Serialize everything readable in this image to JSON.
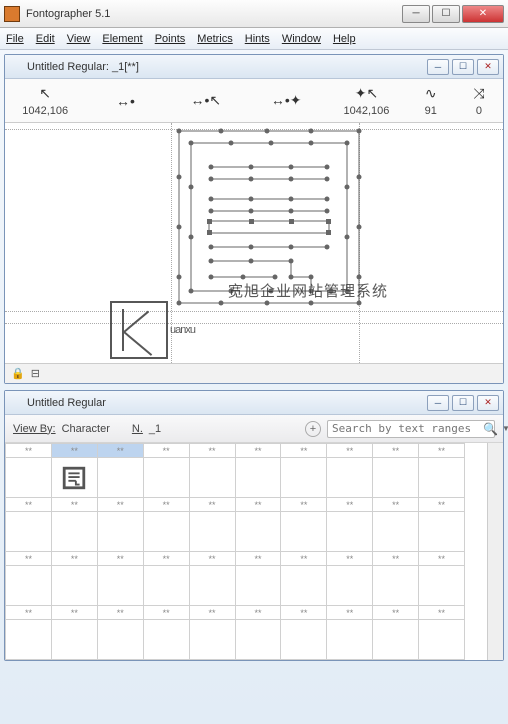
{
  "app": {
    "title": "Fontographer 5.1"
  },
  "menu": {
    "file": "File",
    "edit": "Edit",
    "view": "View",
    "element": "Element",
    "points": "Points",
    "metrics": "Metrics",
    "hints": "Hints",
    "window": "Window",
    "help": "Help"
  },
  "editor": {
    "title": "Untitled Regular: _1[**]",
    "toolbar": {
      "coords_left": "1042,106",
      "coords_right": "1042,106",
      "val_91": "91",
      "val_0": "0",
      "icon1": "↖",
      "icon2": "↔•",
      "icon3": "↔•↖",
      "icon4": "↔•✦",
      "icon5": "✦↖",
      "icon6": "∿",
      "icon7": "⤨"
    },
    "status": {
      "lock": "🔒",
      "slider": "⊟"
    }
  },
  "font_window": {
    "title": "Untitled Regular",
    "view_by_label": "View By:",
    "view_mode": "Character",
    "nav_label": "N.",
    "nav_value": "_1",
    "add_label": "+",
    "search_placeholder": "Search by text ranges",
    "header_cell": "**",
    "selected_index": 1
  },
  "watermark": {
    "cjk": "宽旭企业网站管理系统",
    "latin": "uanxu"
  },
  "colors": {
    "accent": "#3a6aa8",
    "selection": "#bdd4ef"
  }
}
